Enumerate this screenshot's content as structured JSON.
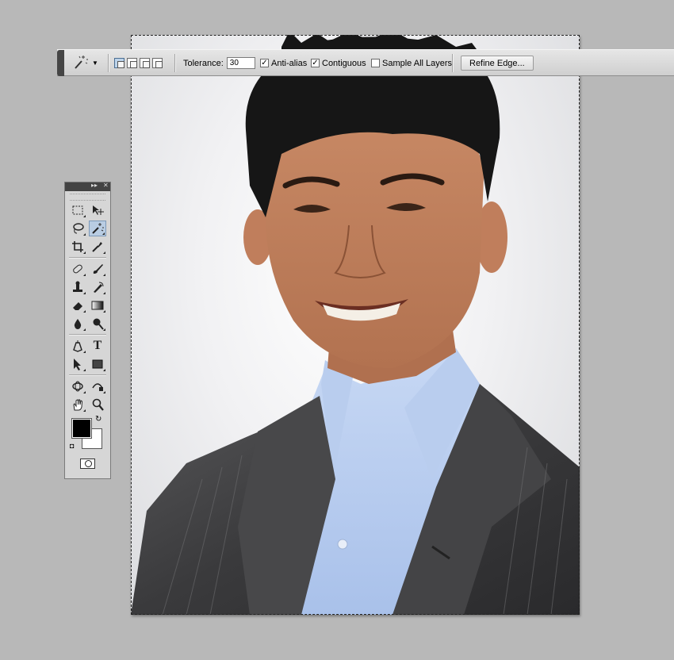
{
  "options_bar": {
    "tool_icon": "magic-wand-icon",
    "selection_modes": [
      "new-selection",
      "add-to-selection",
      "subtract-from-selection",
      "intersect-with-selection"
    ],
    "active_mode": "new-selection",
    "tolerance_label": "Tolerance:",
    "tolerance_value": "30",
    "anti_alias_label": "Anti-alias",
    "anti_alias_checked": true,
    "contiguous_label": "Contiguous",
    "contiguous_checked": true,
    "sample_all_layers_label": "Sample All Layers",
    "sample_all_layers_checked": false,
    "refine_edge_label": "Refine Edge..."
  },
  "tools_panel": {
    "tools": [
      "rectangular-marquee-icon",
      "move-icon",
      "lasso-icon",
      "magic-wand-icon",
      "crop-icon",
      "eyedropper-icon",
      "spot-healing-icon",
      "brush-icon",
      "clone-stamp-icon",
      "history-brush-icon",
      "eraser-icon",
      "gradient-icon",
      "blur-icon",
      "dodge-icon",
      "pen-icon",
      "type-icon",
      "path-selection-icon",
      "rectangle-shape-icon",
      "3d-rotate-icon",
      "3d-orbit-icon",
      "hand-icon",
      "zoom-icon"
    ],
    "active_tool": "magic-wand-icon",
    "type_glyph": "T",
    "foreground_color": "#000000",
    "background_color": "#ffffff"
  },
  "document": {
    "content": "portrait-photo",
    "selection": "marquee-active"
  }
}
